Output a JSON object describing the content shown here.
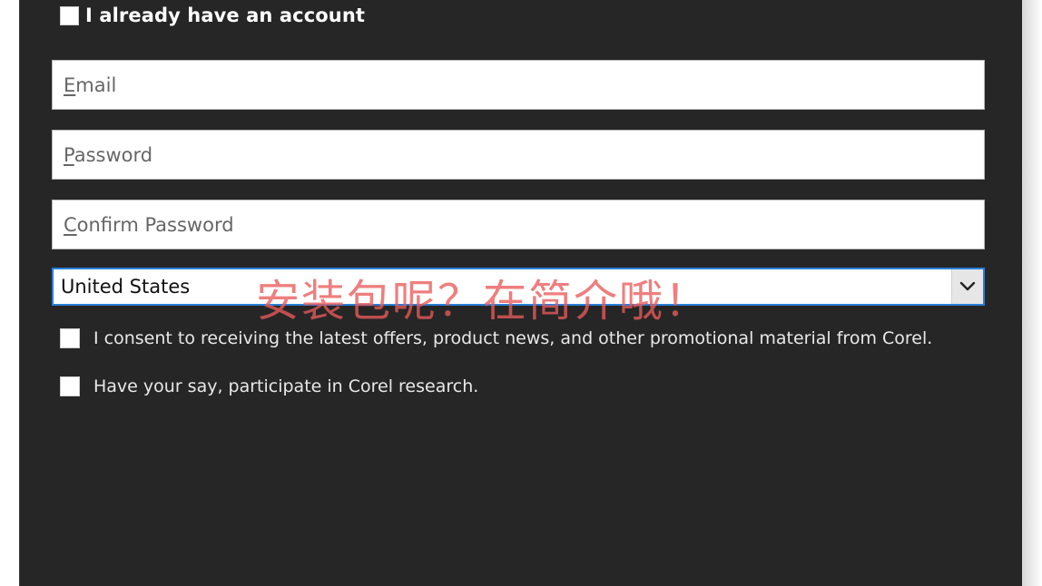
{
  "account": {
    "checkbox_checked": false,
    "label": "I already have an account"
  },
  "fields": {
    "email": {
      "mnemonic": "E",
      "rest": "mail",
      "value": ""
    },
    "password": {
      "mnemonic": "P",
      "rest": "assword",
      "value": ""
    },
    "confirm_password": {
      "mnemonic": "C",
      "rest": "onfirm Password",
      "value": ""
    }
  },
  "country": {
    "selected": "United States",
    "arrow_icon": "chevron-down-icon"
  },
  "consents": [
    {
      "label": "I consent to receiving the latest offers, product news, and other promotional material from Corel.",
      "checked": false
    },
    {
      "label": "Have your say, participate in Corel research.",
      "checked": false
    }
  ],
  "watermark": {
    "text": "安装包呢？在简介哦！",
    "color": "#eb5a5a"
  },
  "colors": {
    "dialog_background": "#262626",
    "select_focus_border": "#2a7fd6"
  }
}
